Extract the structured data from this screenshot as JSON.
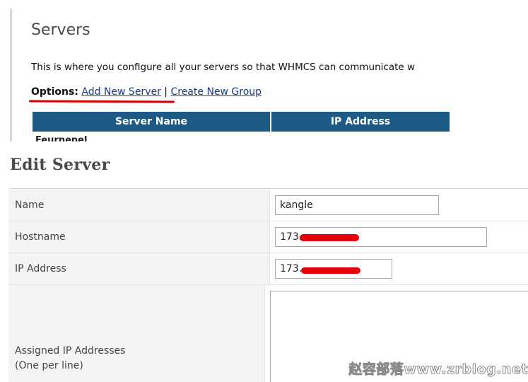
{
  "servers_panel": {
    "title": "Servers",
    "description": "This is where you configure all your servers so that WHMCS can communicate w",
    "options_label": "Options:",
    "add_new_server": "Add New Server",
    "separator": "|",
    "create_new_group": "Create New Group",
    "table_headers": [
      "Server Name",
      "IP Address"
    ],
    "first_row_partial": "Feurnenel"
  },
  "edit_server": {
    "title": "Edit Server",
    "fields": [
      {
        "label": "Name",
        "value": "kangle"
      },
      {
        "label": "Hostname",
        "value": "173."
      },
      {
        "label": "IP Address",
        "value": "173."
      },
      {
        "label_line1": "Assigned IP Addresses",
        "label_line2": "(One per line)",
        "value": ""
      }
    ]
  },
  "watermark": "赵容部落www.zrblog.net",
  "colors": {
    "table_header_bg": "#1d5a86",
    "link": "#1a3a8a",
    "annotation_red": "#d40000",
    "label_bg": "#f4f4f4"
  }
}
